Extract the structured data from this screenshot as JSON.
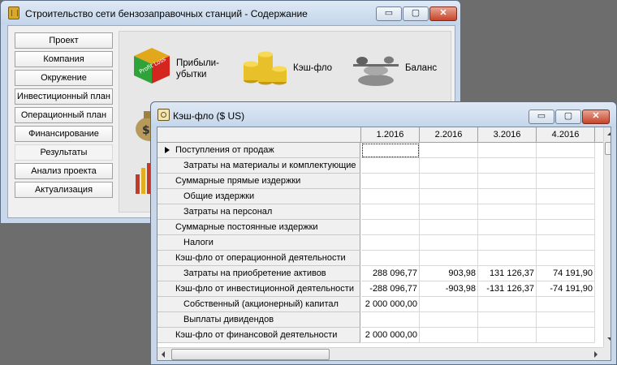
{
  "main_window": {
    "title": "Строительство сети бензозаправочных станций - Содержание",
    "controls": {
      "minimize": "▭",
      "maximize": "▢",
      "close": "✕"
    }
  },
  "nav": [
    "Проект",
    "Компания",
    "Окружение",
    "Инвестиционный план",
    "Операционный план",
    "Финансирование",
    "Результаты",
    "Анализ проекта",
    "Актуализация"
  ],
  "tiles": {
    "profit_label": "Прибыли-\nубытки",
    "profit_icon_text": "Profit Loss",
    "cashflow_label": "Кэш-фло",
    "balance_label": "Баланс"
  },
  "child_window": {
    "title": "Кэш-фло ($ US)",
    "controls": {
      "minimize": "▭",
      "maximize": "▢",
      "close": "✕"
    }
  },
  "table": {
    "columns": [
      "1.2016",
      "2.2016",
      "3.2016",
      "4.2016"
    ],
    "rows": [
      {
        "label": "Поступления от продаж",
        "values": [
          "",
          "",
          "",
          ""
        ]
      },
      {
        "label": "Затраты на материалы и комплектующие",
        "values": [
          "",
          "",
          "",
          ""
        ]
      },
      {
        "label": "Суммарные прямые издержки",
        "values": [
          "",
          "",
          "",
          ""
        ]
      },
      {
        "label": "Общие издержки",
        "values": [
          "",
          "",
          "",
          ""
        ]
      },
      {
        "label": "Затраты на персонал",
        "values": [
          "",
          "",
          "",
          ""
        ]
      },
      {
        "label": "Суммарные постоянные издержки",
        "values": [
          "",
          "",
          "",
          ""
        ]
      },
      {
        "label": "Налоги",
        "values": [
          "",
          "",
          "",
          ""
        ]
      },
      {
        "label": "Кэш-фло от операционной деятельности",
        "values": [
          "",
          "",
          "",
          ""
        ]
      },
      {
        "label": "Затраты на приобретение активов",
        "values": [
          "288 096,77",
          "903,98",
          "131 126,37",
          "74 191,90"
        ]
      },
      {
        "label": "Кэш-фло от инвестиционной деятельности",
        "values": [
          "-288 096,77",
          "-903,98",
          "-131 126,37",
          "-74 191,90"
        ]
      },
      {
        "label": "Собственный (акционерный) капитал",
        "values": [
          "2 000 000,00",
          "",
          "",
          ""
        ]
      },
      {
        "label": "Выплаты дивидендов",
        "values": [
          "",
          "",
          "",
          ""
        ]
      },
      {
        "label": "Кэш-фло от финансовой деятельности",
        "values": [
          "2 000 000,00",
          "",
          "",
          ""
        ]
      }
    ]
  }
}
